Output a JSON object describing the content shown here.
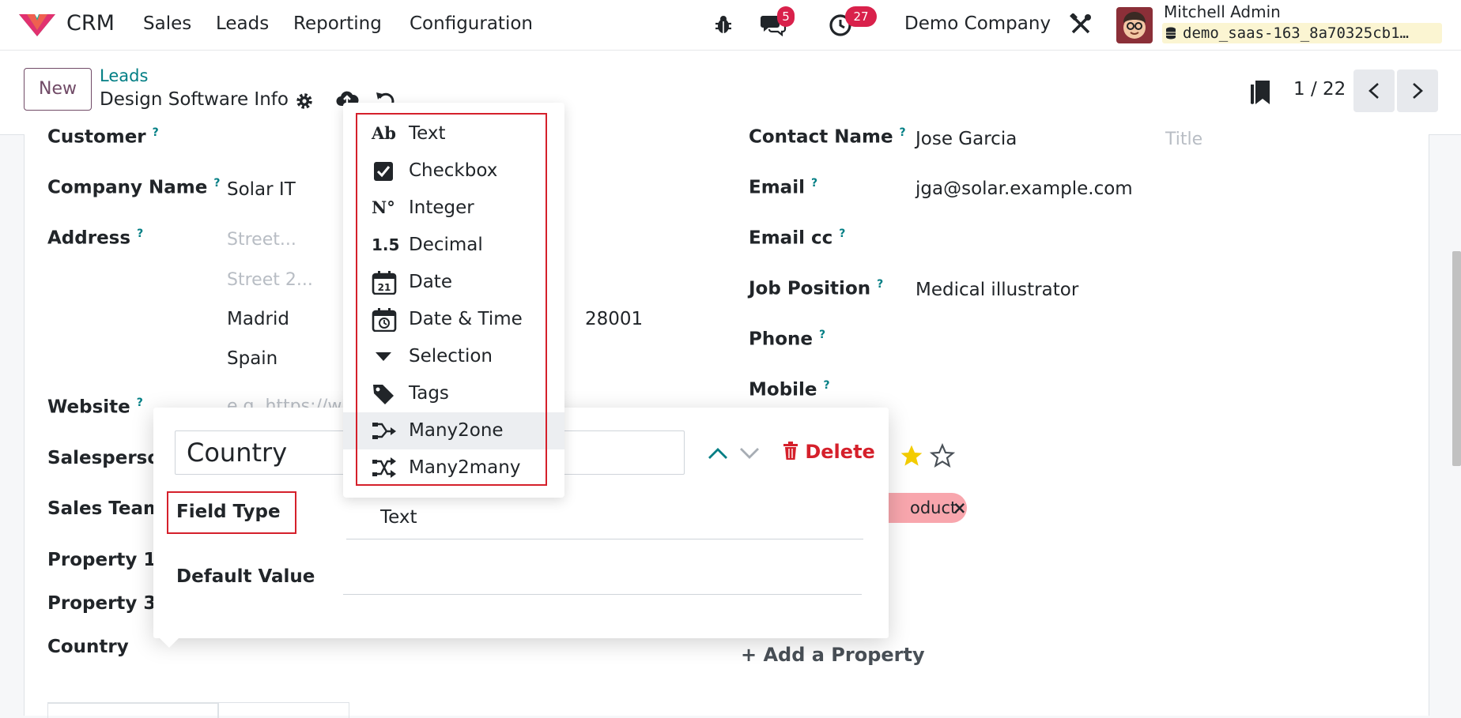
{
  "navbar": {
    "app_name": "CRM",
    "menu": [
      "Sales",
      "Leads",
      "Reporting",
      "Configuration"
    ],
    "messages_count": "5",
    "activities_count": "27",
    "company": "Demo Company",
    "user_name": "Mitchell Admin",
    "database": "demo_saas-163_8a70325cb1…"
  },
  "control_panel": {
    "new_label": "New",
    "breadcrumb": "Leads",
    "record_title": "Design Software Info",
    "pager": "1 / 22"
  },
  "form": {
    "customer_label": "Customer",
    "company_name_label": "Company Name",
    "company_name_value": "Solar IT",
    "address_label": "Address",
    "street_placeholder": "Street...",
    "street2_placeholder": "Street 2...",
    "city": "Madrid",
    "zip": "28001",
    "country": "Spain",
    "website_label": "Website",
    "website_placeholder": "e.g. https://w",
    "salesperson_label": "Salesperson",
    "sales_team_label": "Sales Team",
    "property1_label": "Property 1",
    "property3_label": "Property 3",
    "country_label": "Country",
    "contact_name_label": "Contact Name",
    "contact_name_value": "Jose Garcia",
    "title_placeholder": "Title",
    "email_label": "Email",
    "email_value": "jga@solar.example.com",
    "email_cc_label": "Email cc",
    "job_position_label": "Job Position",
    "job_position_value": "Medical illustrator",
    "phone_label": "Phone",
    "mobile_label": "Mobile",
    "priority": {
      "filled": 1,
      "total": 2
    },
    "tag_label": "oduct",
    "add_property_label": "Add a Property"
  },
  "property_editor": {
    "name_value": "Country",
    "delete_label": "Delete",
    "field_type_label": "Field Type",
    "field_type_value": "Text",
    "default_value_label": "Default Value"
  },
  "field_type_dropdown": {
    "items": [
      {
        "label": "Text",
        "icon": "text-icon"
      },
      {
        "label": "Checkbox",
        "icon": "checkbox-icon"
      },
      {
        "label": "Integer",
        "icon": "integer-icon"
      },
      {
        "label": "Decimal",
        "icon": "decimal-icon"
      },
      {
        "label": "Date",
        "icon": "calendar-icon"
      },
      {
        "label": "Date & Time",
        "icon": "calendar-clock-icon"
      },
      {
        "label": "Selection",
        "icon": "caret-down-icon"
      },
      {
        "label": "Tags",
        "icon": "tag-icon"
      },
      {
        "label": "Many2one",
        "icon": "many2one-icon"
      },
      {
        "label": "Many2many",
        "icon": "many2many-icon"
      }
    ],
    "active_index": 8
  },
  "colors": {
    "brand": "#714b67",
    "link": "#017e84",
    "danger": "#d5202b",
    "badge": "#d9214b",
    "star": "#f3cc00"
  }
}
